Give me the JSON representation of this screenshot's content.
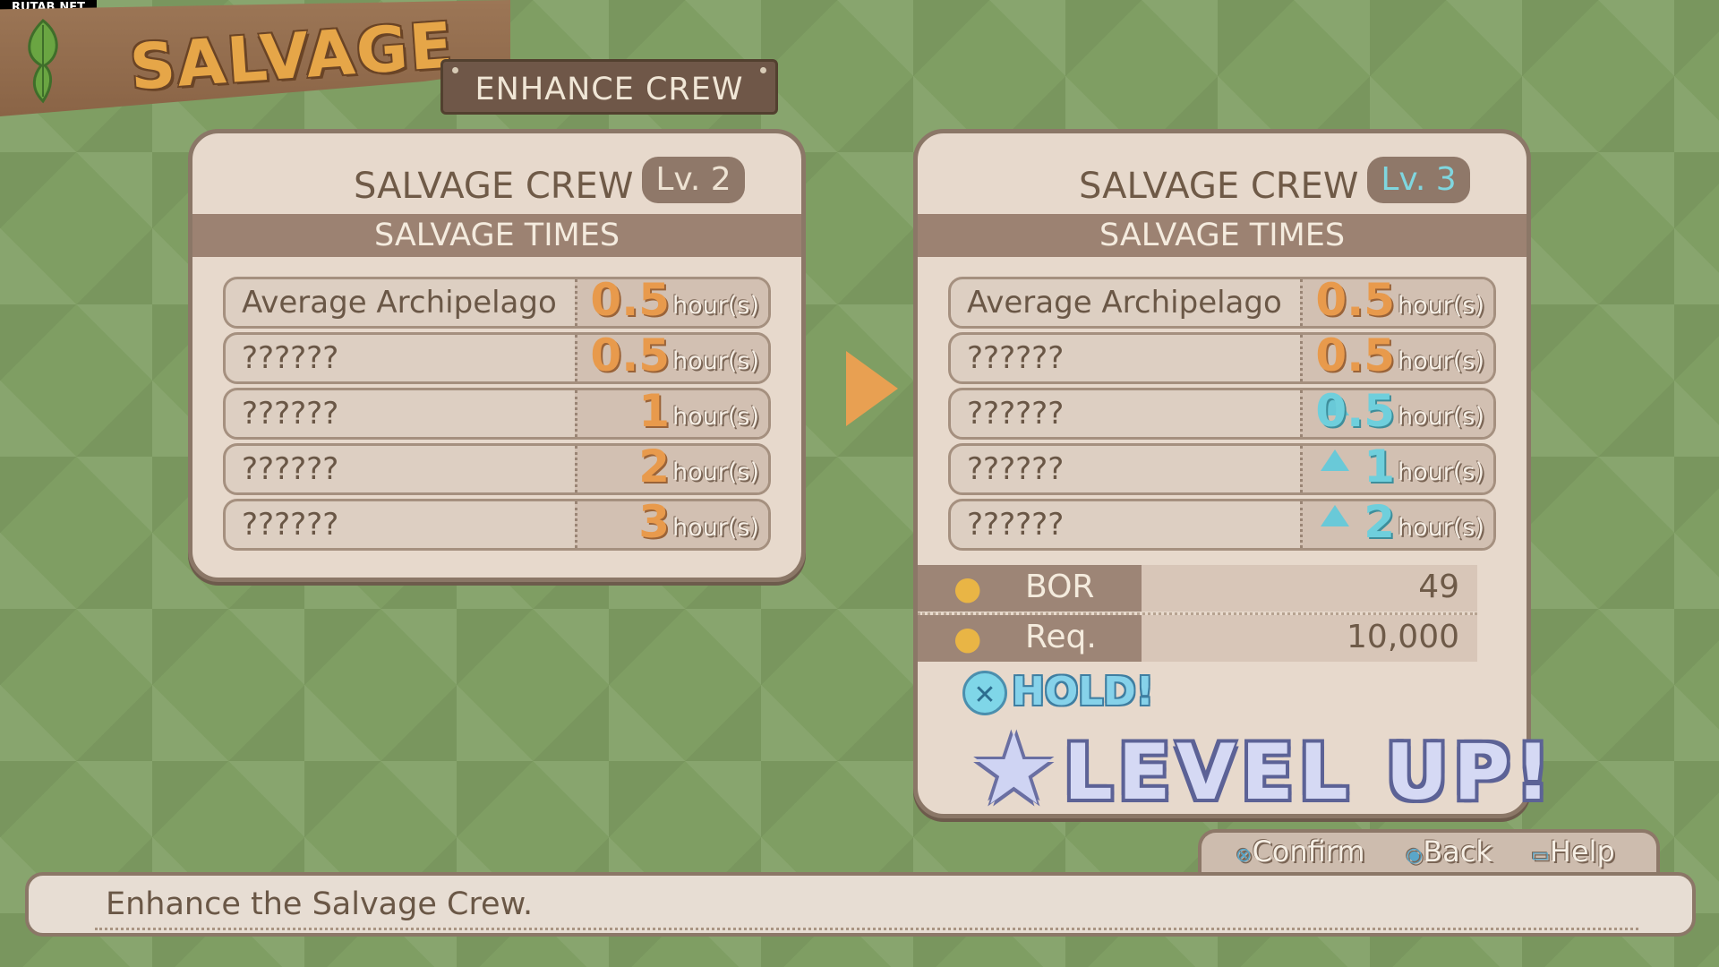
{
  "watermark": "RUTAB.NET",
  "header": {
    "title": "SALVAGE",
    "tab": "ENHANCE CREW"
  },
  "current": {
    "title": "SALVAGE CREW",
    "level": "Lv. 2",
    "section": "SALVAGE TIMES",
    "rows": [
      {
        "label": "Average Archipelago",
        "value": "0.5",
        "unit": "hour(s)"
      },
      {
        "label": "??????",
        "value": "0.5",
        "unit": "hour(s)"
      },
      {
        "label": "??????",
        "value": "1",
        "unit": "hour(s)"
      },
      {
        "label": "??????",
        "value": "2",
        "unit": "hour(s)"
      },
      {
        "label": "??????",
        "value": "3",
        "unit": "hour(s)"
      }
    ]
  },
  "next": {
    "title": "SALVAGE CREW",
    "level": "Lv. 3",
    "section": "SALVAGE TIMES",
    "rows": [
      {
        "label": "Average Archipelago",
        "value": "0.5",
        "unit": "hour(s)",
        "improved": false
      },
      {
        "label": "??????",
        "value": "0.5",
        "unit": "hour(s)",
        "improved": false
      },
      {
        "label": "??????",
        "value": "0.5",
        "unit": "hour(s)",
        "improved": true
      },
      {
        "label": "??????",
        "value": "1",
        "unit": "hour(s)",
        "improved": true
      },
      {
        "label": "??????",
        "value": "2",
        "unit": "hour(s)",
        "improved": true
      }
    ],
    "cost": [
      {
        "label": "BOR",
        "value": "49"
      },
      {
        "label": "Req.",
        "value": "10,000"
      }
    ],
    "hold_label": "HOLD!",
    "level_up_label": "LEVEL UP!"
  },
  "controls": {
    "confirm": "Confirm",
    "back": "Back",
    "help": "Help"
  },
  "footer": {
    "message": "Enhance the Salvage Crew."
  },
  "colors": {
    "background": "#7f9e63",
    "wood": "#8a6446",
    "orange_value": "#e89a4c",
    "blue_value": "#6fcfdc",
    "panel": "#e7d9cc"
  }
}
